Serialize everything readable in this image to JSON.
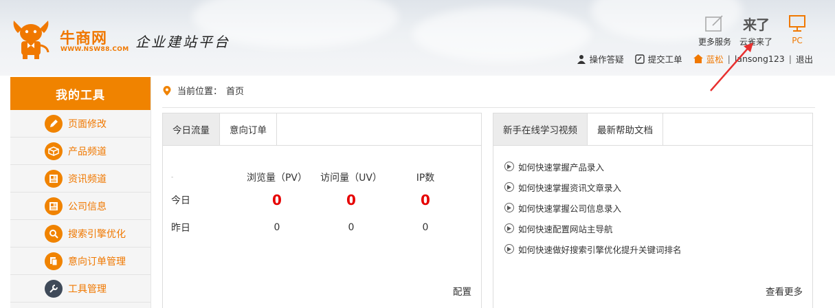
{
  "header": {
    "logo_text": "牛商网",
    "logo_sub": "WWW.NSW88.COM",
    "slogan": "企业建站平台",
    "services": [
      {
        "label": "更多服务",
        "icon": "edit-box-icon"
      },
      {
        "label": "云雀来了",
        "icon": "laile-icon",
        "mark": "来了"
      },
      {
        "label": "PC",
        "icon": "monitor-icon"
      }
    ],
    "user_bar": {
      "help": "操作答疑",
      "ticket": "提交工单",
      "site": "蓝松",
      "account": "lansong123",
      "sep": "|",
      "logout": "退出"
    }
  },
  "sidebar": {
    "title": "我的工具",
    "items": [
      {
        "label": "页面修改",
        "icon": "pencil-icon"
      },
      {
        "label": "产品频道",
        "icon": "box-icon"
      },
      {
        "label": "资讯频道",
        "icon": "news-icon"
      },
      {
        "label": "公司信息",
        "icon": "news-icon"
      },
      {
        "label": "搜索引擎优化",
        "icon": "search-icon"
      },
      {
        "label": "意向订单管理",
        "icon": "copy-icon"
      },
      {
        "label": "工具管理",
        "icon": "wrench-icon"
      }
    ]
  },
  "breadcrumb": {
    "prefix": "当前位置：",
    "current": "首页"
  },
  "traffic": {
    "tabs": [
      "今日流量",
      "意向订单"
    ],
    "headers": [
      "-",
      "浏览量（PV）",
      "访问量（UV）",
      "IP数"
    ],
    "rows": [
      {
        "label": "今日",
        "pv": "0",
        "uv": "0",
        "ip": "0"
      },
      {
        "label": "昨日",
        "pv": "0",
        "uv": "0",
        "ip": "0"
      }
    ],
    "config": "配置"
  },
  "help": {
    "tabs": [
      "新手在线学习视频",
      "最新帮助文档"
    ],
    "links": [
      "如何快速掌握产品录入",
      "如何快速掌握资讯文章录入",
      "如何快速掌握公司信息录入",
      "如何快速配置网站主导航",
      "如何快速做好搜索引擎优化提升关键词排名"
    ],
    "more": "查看更多"
  },
  "colors": {
    "accent": "#f08300",
    "red": "#e60000",
    "arrow": "#e8302f"
  }
}
